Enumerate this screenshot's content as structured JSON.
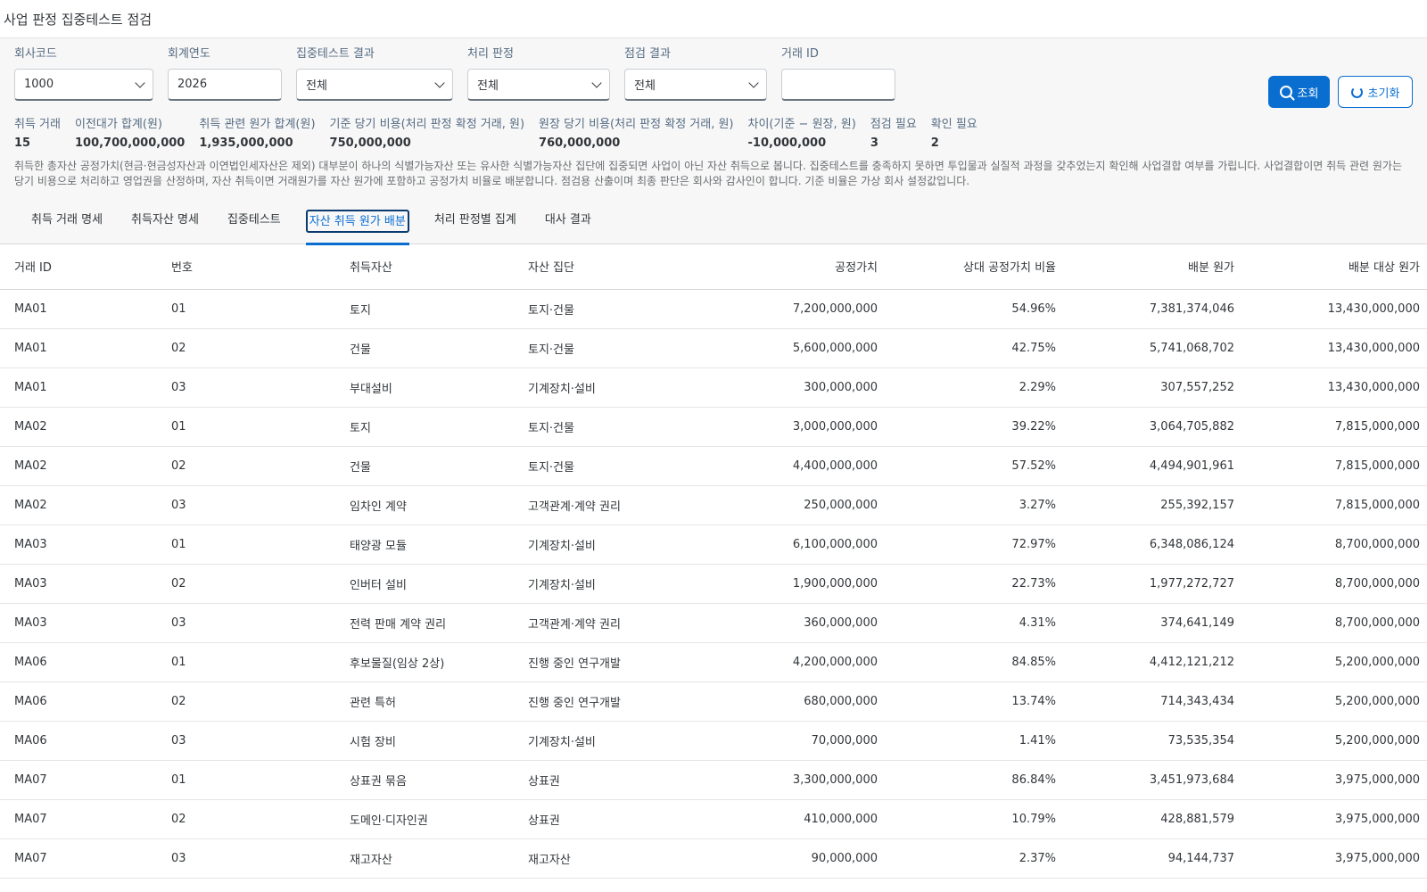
{
  "app": {
    "title": "사업 판정 집중테스트 점검"
  },
  "filters": {
    "company": {
      "label": "회사코드",
      "value": "1000"
    },
    "year": {
      "label": "회계연도",
      "value": "2026"
    },
    "concentration": {
      "label": "집중테스트 결과",
      "value": "전체"
    },
    "treatment": {
      "label": "처리 판정",
      "value": "전체"
    },
    "review": {
      "label": "점검 결과",
      "value": "전체"
    },
    "txn": {
      "label": "거래 ID",
      "value": ""
    },
    "search_label": "조회",
    "reset_label": "초기화"
  },
  "summary": [
    {
      "label": "취득 거래",
      "value": "15"
    },
    {
      "label": "이전대가 합계(원)",
      "value": "100,700,000,000"
    },
    {
      "label": "취득 관련 원가 합계(원)",
      "value": "1,935,000,000"
    },
    {
      "label": "기준 당기 비용(처리 판정 확정 거래, 원)",
      "value": "750,000,000"
    },
    {
      "label": "원장 당기 비용(처리 판정 확정 거래, 원)",
      "value": "760,000,000"
    },
    {
      "label": "차이(기준 − 원장, 원)",
      "value": "-10,000,000"
    },
    {
      "label": "점검 필요",
      "value": "3"
    },
    {
      "label": "확인 필요",
      "value": "2"
    }
  ],
  "note": "취득한 총자산 공정가치(현금·현금성자산과 이연법인세자산은 제외) 대부분이 하나의 식별가능자산 또는 유사한 식별가능자산 집단에 집중되면 사업이 아닌 자산 취득으로 봅니다. 집중테스트를 충족하지 못하면 투입물과 실질적 과정을 갖추었는지 확인해 사업결합 여부를 가립니다. 사업결합이면 취득 관련 원가는 당기 비용으로 처리하고 영업권을 산정하며, 자산 취득이면 거래원가를 자산 원가에 포함하고 공정가치 비율로 배분합니다. 점검용 산출이며 최종 판단은 회사와 감사인이 합니다. 기준 비율은 가상 회사 설정값입니다.",
  "tabs": [
    "취득 거래 명세",
    "취득자산 명세",
    "집중테스트",
    "자산 취득 원가 배분",
    "처리 판정별 집계",
    "대사 결과"
  ],
  "active_tab": 3,
  "table": {
    "columns": [
      "거래 ID",
      "번호",
      "취득자산",
      "자산 집단",
      "공정가치",
      "상대 공정가치 비율",
      "배분 원가",
      "배분 대상 원가"
    ],
    "rows": [
      [
        "MA01",
        "01",
        "토지",
        "토지·건물",
        "7,200,000,000",
        "54.96%",
        "7,381,374,046",
        "13,430,000,000"
      ],
      [
        "MA01",
        "02",
        "건물",
        "토지·건물",
        "5,600,000,000",
        "42.75%",
        "5,741,068,702",
        "13,430,000,000"
      ],
      [
        "MA01",
        "03",
        "부대설비",
        "기계장치·설비",
        "300,000,000",
        "2.29%",
        "307,557,252",
        "13,430,000,000"
      ],
      [
        "MA02",
        "01",
        "토지",
        "토지·건물",
        "3,000,000,000",
        "39.22%",
        "3,064,705,882",
        "7,815,000,000"
      ],
      [
        "MA02",
        "02",
        "건물",
        "토지·건물",
        "4,400,000,000",
        "57.52%",
        "4,494,901,961",
        "7,815,000,000"
      ],
      [
        "MA02",
        "03",
        "임차인 계약",
        "고객관계·계약 권리",
        "250,000,000",
        "3.27%",
        "255,392,157",
        "7,815,000,000"
      ],
      [
        "MA03",
        "01",
        "태양광 모듈",
        "기계장치·설비",
        "6,100,000,000",
        "72.97%",
        "6,348,086,124",
        "8,700,000,000"
      ],
      [
        "MA03",
        "02",
        "인버터 설비",
        "기계장치·설비",
        "1,900,000,000",
        "22.73%",
        "1,977,272,727",
        "8,700,000,000"
      ],
      [
        "MA03",
        "03",
        "전력 판매 계약 권리",
        "고객관계·계약 권리",
        "360,000,000",
        "4.31%",
        "374,641,149",
        "8,700,000,000"
      ],
      [
        "MA06",
        "01",
        "후보물질(임상 2상)",
        "진행 중인 연구개발",
        "4,200,000,000",
        "84.85%",
        "4,412,121,212",
        "5,200,000,000"
      ],
      [
        "MA06",
        "02",
        "관련 특허",
        "진행 중인 연구개발",
        "680,000,000",
        "13.74%",
        "714,343,434",
        "5,200,000,000"
      ],
      [
        "MA06",
        "03",
        "시험 장비",
        "기계장치·설비",
        "70,000,000",
        "1.41%",
        "73,535,354",
        "5,200,000,000"
      ],
      [
        "MA07",
        "01",
        "상표권 묶음",
        "상표권",
        "3,300,000,000",
        "86.84%",
        "3,451,973,684",
        "3,975,000,000"
      ],
      [
        "MA07",
        "02",
        "도메인·디자인권",
        "상표권",
        "410,000,000",
        "10.79%",
        "428,881,579",
        "3,975,000,000"
      ],
      [
        "MA07",
        "03",
        "재고자산",
        "재고자산",
        "90,000,000",
        "2.37%",
        "94,144,737",
        "3,975,000,000"
      ]
    ]
  },
  "colors": {
    "accent": "#0a6ed1",
    "text": "#32363a",
    "muted": "#556b82",
    "panel": "#f7f7f7"
  },
  "icons": {
    "search": "search-icon",
    "reset": "reset-icon",
    "dropdown": "chevron-down-icon"
  }
}
